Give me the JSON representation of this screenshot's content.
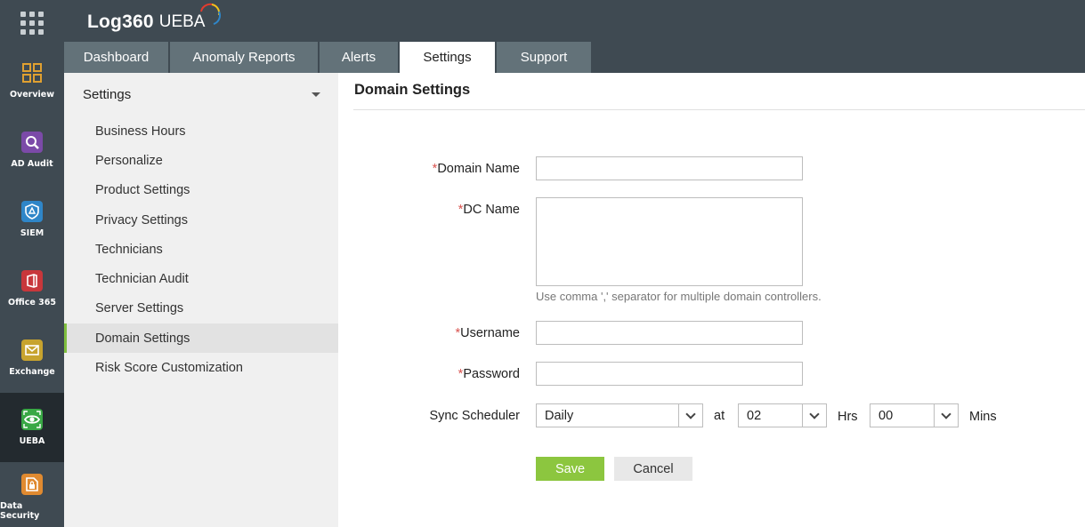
{
  "app": {
    "logo_main": "Log360",
    "logo_sub": "UEBA"
  },
  "rail": {
    "items": [
      {
        "label": "Overview",
        "icon": "overview-icon",
        "color": "#e0a030"
      },
      {
        "label": "AD Audit",
        "icon": "ad-audit-icon",
        "color": "#7b4aa8"
      },
      {
        "label": "SIEM",
        "icon": "siem-icon",
        "color": "#2f86c8"
      },
      {
        "label": "Office 365",
        "icon": "office365-icon",
        "color": "#c8373b"
      },
      {
        "label": "Exchange",
        "icon": "exchange-icon",
        "color": "#c7a32e"
      },
      {
        "label": "UEBA",
        "icon": "ueba-icon",
        "color": "#39a845"
      },
      {
        "label": "Data Security",
        "icon": "data-security-icon",
        "color": "#e08a30"
      }
    ]
  },
  "tabs": [
    {
      "label": "Dashboard"
    },
    {
      "label": "Anomaly Reports"
    },
    {
      "label": "Alerts"
    },
    {
      "label": "Settings"
    },
    {
      "label": "Support"
    }
  ],
  "sidepanel": {
    "title": "Settings",
    "items": [
      {
        "label": "Business Hours"
      },
      {
        "label": "Personalize"
      },
      {
        "label": "Product Settings"
      },
      {
        "label": "Privacy Settings"
      },
      {
        "label": "Technicians"
      },
      {
        "label": "Technician Audit"
      },
      {
        "label": "Server Settings"
      },
      {
        "label": "Domain Settings"
      },
      {
        "label": "Risk Score Customization"
      }
    ]
  },
  "main": {
    "title": "Domain Settings",
    "required_mark": "*",
    "domain_name_label": "Domain Name",
    "domain_name_value": "",
    "dc_name_label": "DC Name",
    "dc_name_value": "",
    "dc_hint": "Use comma ',' separator for multiple domain controllers.",
    "username_label": "Username",
    "username_value": "",
    "password_label": "Password",
    "password_value": "",
    "sync_label": "Sync Scheduler",
    "frequency": "Daily",
    "at_label": "at",
    "hours": "02",
    "hrs_label": "Hrs",
    "minutes": "00",
    "mins_label": "Mins",
    "save_label": "Save",
    "cancel_label": "Cancel"
  },
  "colors": {
    "rail_bg": "#3f4a52",
    "tab_bg": "#637279",
    "accent_green": "#8cc63f",
    "required_red": "#d9534f"
  }
}
